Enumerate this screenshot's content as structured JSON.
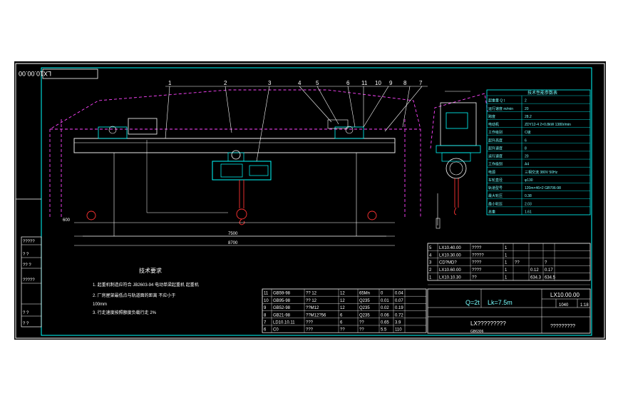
{
  "drawing": {
    "number_box": "LX10.00.00",
    "colors": {
      "background": "#000000",
      "frame": "#00ffff",
      "outline": "#ffffff",
      "hidden": "#ff44ff",
      "hook": "#ff3333"
    },
    "callouts": [
      "1",
      "2",
      "3",
      "4",
      "5",
      "6",
      "11",
      "10",
      "9",
      "8",
      "7"
    ],
    "dimensions": {
      "span_inner": "7500",
      "span_outer": "8700",
      "left_offset": "600"
    }
  },
  "tech_requirements": {
    "title": "技术要求",
    "lines": [
      "1. 起重机制造应符合 JB2603-94 电动单梁起重机 起重机",
      "2. 厂房屋架最低点与轨道面的距离 不应小于",
      "   100mm",
      "3. 行走速度按照额度负载行走 2%"
    ]
  },
  "param_table": {
    "title": "技术性能参数表",
    "rows": [
      {
        "label": "起重量 Q t",
        "value": "2"
      },
      {
        "label": "运行速度 m/min",
        "value": "20"
      },
      {
        "label": "跨度",
        "value": "28.2"
      },
      {
        "label": "电动机",
        "value": "ZDY12-4 2×0.8kW 1380r/min"
      },
      {
        "label": "工作级别",
        "value": "C级"
      },
      {
        "label": "起升高度",
        "value": "6"
      },
      {
        "label": "起升速度",
        "value": "8"
      },
      {
        "label": "运行速度",
        "value": "20"
      },
      {
        "label": "工作级别",
        "value": "A4"
      },
      {
        "label": "电源",
        "value": "三相交流 380V 50Hz"
      },
      {
        "label": "车轮直径",
        "value": "φ130"
      },
      {
        "label": "轨道型号",
        "value": "120m×46×2 GB706-98"
      },
      {
        "label": "最大轮压",
        "value": "0.38"
      },
      {
        "label": "最小轮压",
        "value": "2.03"
      },
      {
        "label": "总重",
        "value": "1.61"
      }
    ]
  },
  "parts_upper": [
    {
      "no": "5",
      "code": "LX10.40.00",
      "name": "????",
      "qty": "1",
      "c5": "",
      "c6": "",
      "c7": ""
    },
    {
      "no": "4",
      "code": "LX10.30.00",
      "name": "?????",
      "qty": "1",
      "c5": "",
      "c6": "",
      "c7": ""
    },
    {
      "no": "3",
      "code": "CD?MD?",
      "name": "????",
      "qty": "1",
      "c5": "??",
      "c6": "",
      "c7": "?"
    },
    {
      "no": "2",
      "code": "LX10.60.00",
      "name": "????",
      "qty": "1",
      "c5": "",
      "c6": "0.12",
      "c7": "0.17"
    },
    {
      "no": "1",
      "code": "LX10.10.30",
      "name": "??",
      "qty": "1",
      "c5": "",
      "c6": "634.3",
      "c7": "634.5"
    }
  ],
  "parts_lower": [
    {
      "no": "11",
      "code": "GB59-98",
      "name": "?? 12",
      "qty": "12",
      "mat": "65Mn",
      "c6": "0",
      "c7": "0.04"
    },
    {
      "no": "10",
      "code": "GB95-98",
      "name": "?? 12",
      "qty": "12",
      "mat": "Q235",
      "c6": "0.01",
      "c7": "0.07"
    },
    {
      "no": "9",
      "code": "GB52-98",
      "name": "??M12",
      "qty": "12",
      "mat": "Q235",
      "c6": "0.02",
      "c7": "0.19"
    },
    {
      "no": "8",
      "code": "GB21-98",
      "name": "??M12?56",
      "qty": "6",
      "mat": "Q235",
      "c6": "0.06",
      "c7": "0.72"
    },
    {
      "no": "7",
      "code": "LD10.10.11",
      "name": "???",
      "qty": "6",
      "mat": "??",
      "c6": "0.65",
      "c7": "3.9"
    },
    {
      "no": "6",
      "code": "C0",
      "name": "???",
      "qty": "??",
      "mat": "??",
      "c6": "5.5",
      "c7": "110"
    }
  ],
  "title_block": {
    "spec_q": "Q=2t",
    "spec_lk": "Lk=7.5m",
    "drawing_no": "LX10.00.00",
    "product_name": "LX?????????",
    "company": "?????????",
    "weight": "1040",
    "scale": "1:18",
    "footer_code": "GB6306"
  },
  "left_strip": [
    "?????",
    "?  ?",
    "??  ?",
    "?????",
    "?  ?",
    "?  ?"
  ]
}
